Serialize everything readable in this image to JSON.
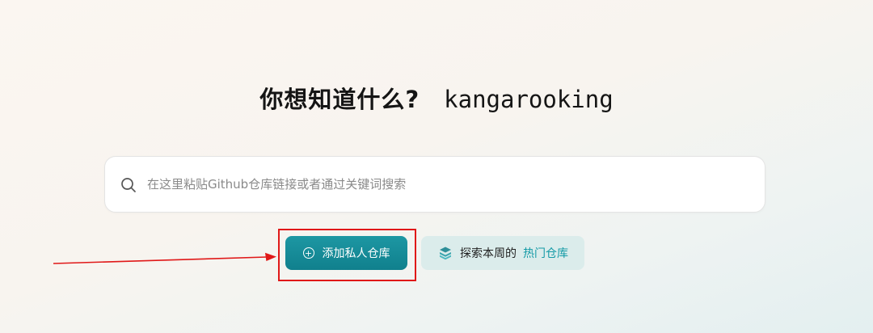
{
  "headline": {
    "question": "你想知道什么?",
    "username": "kangarooking"
  },
  "search": {
    "icon": "search-icon",
    "placeholder": "在这里粘贴Github仓库链接或者通过关键词搜索"
  },
  "actions": {
    "add_private": {
      "icon": "plus-circle-icon",
      "label": "添加私人仓库"
    },
    "explore": {
      "icon": "book-icon",
      "label": "探索本周的",
      "accent_label": "热门仓库"
    }
  },
  "colors": {
    "primary": "#10808d",
    "accent_text": "#139aa6",
    "annotation": "#e01818",
    "explore_bg": "#dbeceb"
  }
}
